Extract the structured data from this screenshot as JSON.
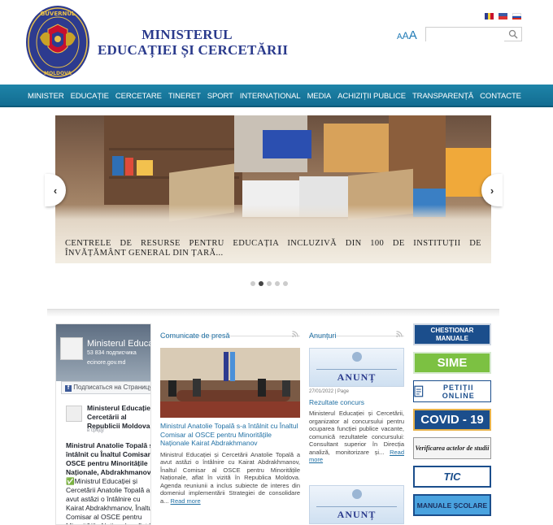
{
  "header": {
    "title_line1": "MINISTERUL",
    "title_line2": "EDUCAȚIEI ȘI CERCETĂRII",
    "font_size_small": "A",
    "font_size_medium": "A",
    "font_size_large": "A",
    "search_placeholder": "",
    "languages": [
      "ro",
      "en",
      "ru"
    ]
  },
  "nav": {
    "items": [
      "Minister",
      "Educație",
      "Cercetare",
      "Tineret",
      "Sport",
      "Internațional",
      "Media",
      "Achiziții publice",
      "Transparență",
      "Contacte"
    ]
  },
  "slider": {
    "caption": "CENTRELE DE RESURSE PENTRU EDUCAȚIA INCLUZIVĂ DIN 100 DE INSTITUȚII DE ÎNVĂȚĂMÂNT GENERAL DIN ȚARĂ...",
    "prev_icon": "‹",
    "next_icon": "›",
    "dots_count": 5,
    "active_dot": 1
  },
  "facebook": {
    "page_name": "Ministerul Educați",
    "likes": "53 834 подписчика",
    "url": "ecinore.gov.md",
    "subscribe_label": "Подписаться на Страницу",
    "post_author": "Ministerul Educației și Cercetării al Republicii Moldova",
    "post_time": "в среду",
    "post_headline": "Ministrul Anatolie Topală s-a întâlnit cu Înaltul Comisar al OSCE pentru Minoritățile Naționale, Abdrakhmanov",
    "post_text": "✅Ministrul Educației și Cercetării Anatolie Topală a avut astăzi o întâlnire cu Kairat Abdrakhmanov, Înaltul Comisar al OSCE pentru Minoritățile Naționale, aflat în vizită în Republica Moldova."
  },
  "press": {
    "heading": "Comunicate de presă",
    "title": "Ministrul Anatolie Topală s-a întâlnit cu Înaltul Comisar al OSCE pentru Minoritățile Naționale Kairat Abdrakhmanov",
    "body": "Ministrul Educației și Cercetării Anatolie Topală a avut astăzi o întâlnire cu Kairat Abdrakhmanov, Înaltul Comisar al OSCE pentru Minoritățile Naționale, aflat în vizită în Republica Moldova. Agenda reuniunii a inclus subiecte de interes din domeniul implementării Strategiei de consolidare a...",
    "read_more": "Read more"
  },
  "announcements": {
    "heading": "Anunțuri",
    "image_text": "ANUNȚ",
    "date": "27/01/2022 | Page",
    "title": "Rezultate concurs",
    "body": "Ministerul Educației și Cercetării, organizator al concursului pentru ocuparea funcției publice vacante, comunică rezultatele concursului: Consultant superior în Direcția analiză, monitorizare și...",
    "read_more": "Read more",
    "image_text_2": "ANUNȚ"
  },
  "banners": {
    "b1": "CHESTIONAR MANUALE",
    "b2": "SIME",
    "b3": "PETIȚII ONLINE",
    "b4": "COVID - 19",
    "b5": "Verificarea actelor de studii",
    "b6": "TIC",
    "b7": "MANUALE ȘCOLARE"
  }
}
